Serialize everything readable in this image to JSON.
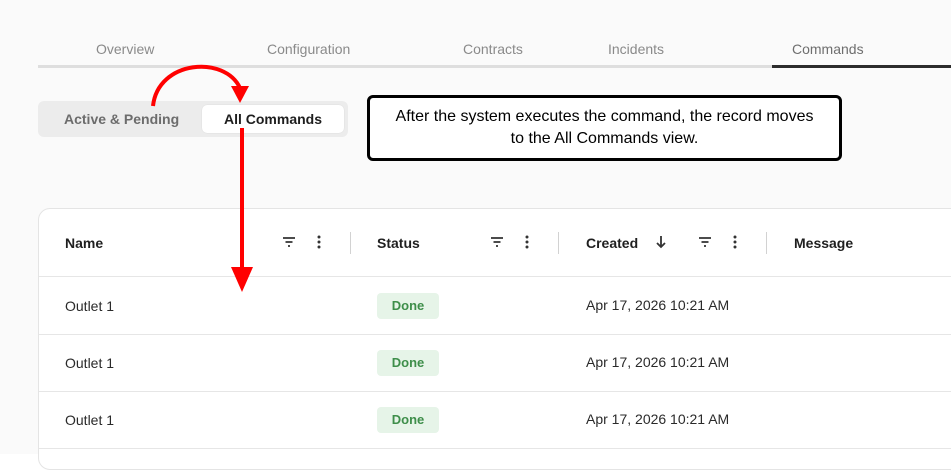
{
  "tabs": [
    {
      "label": "Overview"
    },
    {
      "label": "Configuration"
    },
    {
      "label": "Contracts"
    },
    {
      "label": "Incidents"
    },
    {
      "label": "Commands"
    }
  ],
  "active_tab": "Commands",
  "segmented": {
    "inactive_label": "Active & Pending",
    "active_label": "All Commands"
  },
  "callout": {
    "text": "After the system executes the command, the record moves to the All Commands view."
  },
  "table": {
    "columns": [
      "Name",
      "Status",
      "Created",
      "Message"
    ],
    "sort_column": "Created",
    "rows": [
      {
        "name": "Outlet 1",
        "status": "Done",
        "created": "Apr 17, 2026 10:21 AM",
        "message": ""
      },
      {
        "name": "Outlet 1",
        "status": "Done",
        "created": "Apr 17, 2026 10:21 AM",
        "message": ""
      },
      {
        "name": "Outlet 1",
        "status": "Done",
        "created": "Apr 17, 2026 10:21 AM",
        "message": ""
      }
    ]
  },
  "colors": {
    "annotation_red": "#ff0000",
    "badge_bg": "#e6f4e8",
    "badge_text": "#3e8e4a"
  }
}
